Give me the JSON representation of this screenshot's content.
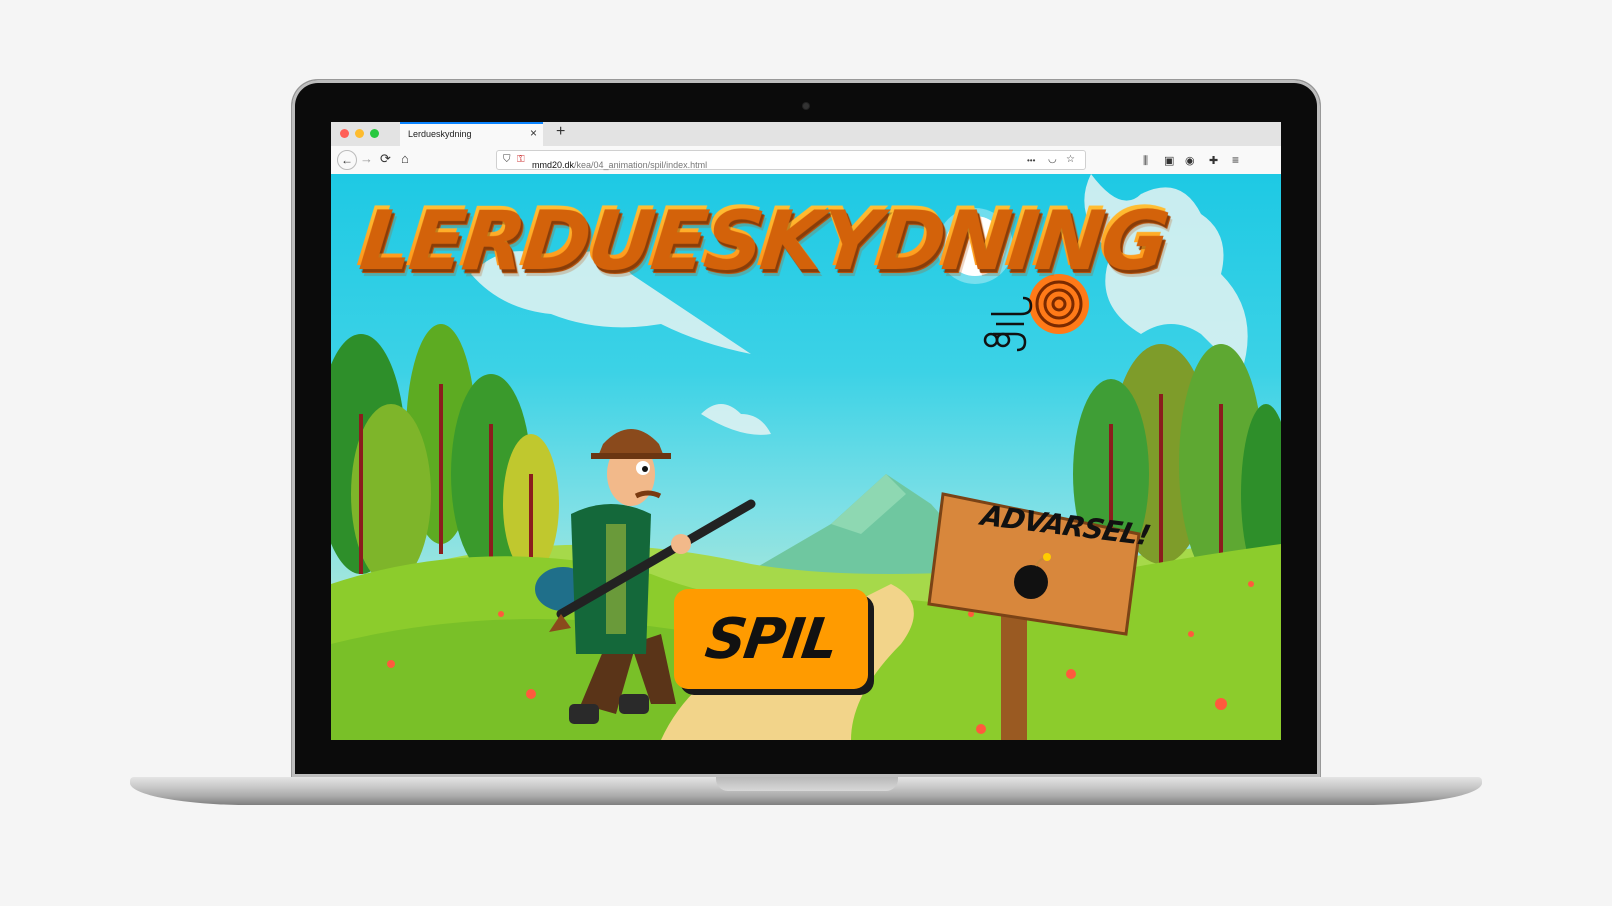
{
  "browser": {
    "tab_title": "Lerdueskydning",
    "tab_close": "×",
    "new_tab": "+",
    "url_host": "mmd20.dk",
    "url_path": "/kea/04_animation/spil/index.html",
    "nav": {
      "back": "←",
      "forward": "→",
      "reload": "⟳",
      "home": "⌂"
    },
    "url_icons": {
      "more": "•••",
      "pocket": "◡",
      "star": "☆"
    },
    "toolbar_icons": {
      "library": "⫼",
      "sidebar": "▣",
      "account": "◉",
      "extension": "✚",
      "menu": "≡"
    }
  },
  "game": {
    "title": "LERDUESKYDNING",
    "play_button": "SPIL",
    "warning_sign": "ADVARSEL!"
  },
  "colors": {
    "title_orange": "#ff9b00",
    "button_orange": "#ff9b00",
    "sky": "#1ec9e4",
    "grass": "#8ccc2c",
    "tab_accent": "#0a84ff"
  }
}
